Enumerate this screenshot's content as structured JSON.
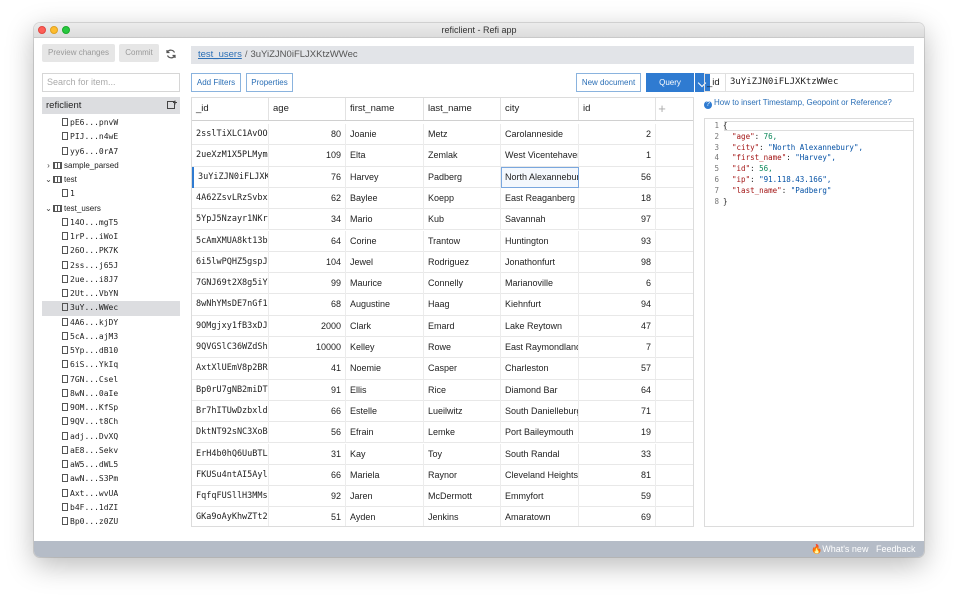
{
  "window": {
    "title": "reficlient - Refi app"
  },
  "sidebar": {
    "preview_label": "Preview changes",
    "commit_label": "Commit",
    "search_placeholder": "Search for item...",
    "root_label": "reficlient",
    "tree": [
      {
        "kind": "doc",
        "label": "pE6...pnvW",
        "indent": 2
      },
      {
        "kind": "doc",
        "label": "PIJ...n4wE",
        "indent": 2
      },
      {
        "kind": "doc",
        "label": "yy6...0rA7",
        "indent": 2
      },
      {
        "kind": "collection",
        "label": "sample_parsed",
        "indent": 0,
        "expanded": false
      },
      {
        "kind": "collection",
        "label": "test",
        "indent": 0,
        "expanded": true
      },
      {
        "kind": "doc",
        "label": "1",
        "indent": 2
      },
      {
        "kind": "collection",
        "label": "test_users",
        "indent": 0,
        "expanded": true
      },
      {
        "kind": "doc",
        "label": "14O...mgT5",
        "indent": 2
      },
      {
        "kind": "doc",
        "label": "1rP...iWoI",
        "indent": 2
      },
      {
        "kind": "doc",
        "label": "26O...PK7K",
        "indent": 2
      },
      {
        "kind": "doc",
        "label": "2ss...j65J",
        "indent": 2
      },
      {
        "kind": "doc",
        "label": "2ue...i8J7",
        "indent": 2
      },
      {
        "kind": "doc",
        "label": "2Ut...VbYN",
        "indent": 2
      },
      {
        "kind": "doc",
        "label": "3uY...WWec",
        "indent": 2,
        "selected": true
      },
      {
        "kind": "doc",
        "label": "4A6...kjDY",
        "indent": 2
      },
      {
        "kind": "doc",
        "label": "5cA...ajM3",
        "indent": 2
      },
      {
        "kind": "doc",
        "label": "5Yp...dB10",
        "indent": 2
      },
      {
        "kind": "doc",
        "label": "6iS...YkIq",
        "indent": 2
      },
      {
        "kind": "doc",
        "label": "7GN...Csel",
        "indent": 2
      },
      {
        "kind": "doc",
        "label": "8wN...0aIe",
        "indent": 2
      },
      {
        "kind": "doc",
        "label": "9OM...KfSp",
        "indent": 2
      },
      {
        "kind": "doc",
        "label": "9QV...t8Ch",
        "indent": 2
      },
      {
        "kind": "doc",
        "label": "adj...DvXQ",
        "indent": 2
      },
      {
        "kind": "doc",
        "label": "aE8...Sekv",
        "indent": 2
      },
      {
        "kind": "doc",
        "label": "aW5...dWL5",
        "indent": 2
      },
      {
        "kind": "doc",
        "label": "awN...S3Pm",
        "indent": 2
      },
      {
        "kind": "doc",
        "label": "Axt...wvUA",
        "indent": 2
      },
      {
        "kind": "doc",
        "label": "b4F...1dZI",
        "indent": 2
      },
      {
        "kind": "doc",
        "label": "Bp0...z0ZU",
        "indent": 2
      }
    ]
  },
  "breadcrumb": {
    "collection": "test_users",
    "separator": "/",
    "document": "3uYiZJN0iFLJXKtzWWec"
  },
  "toolbar": {
    "add_filters": "Add Filters",
    "properties": "Properties",
    "new_document": "New document",
    "query": "Query"
  },
  "table": {
    "columns": [
      "_id",
      "age",
      "first_name",
      "last_name",
      "city",
      "id"
    ],
    "add_column": "+",
    "rows": [
      [
        "2sslTiXLC1AvOO",
        "80",
        "Joanie",
        "Metz",
        "Carolanneside",
        "2"
      ],
      [
        "2ueXzM1X5PLMym",
        "109",
        "Elta",
        "Zemlak",
        "West Vicentehaven",
        "1"
      ],
      [
        "3uYiZJN0iFLJXK",
        "76",
        "Harvey",
        "Padberg",
        "North Alexannebury",
        "56"
      ],
      [
        "4A62ZsvLRzSvbx",
        "62",
        "Baylee",
        "Koepp",
        "East Reaganberg",
        "18"
      ],
      [
        "5YpJ5Nzayr1NKr",
        "34",
        "Mario",
        "Kub",
        "Savannah",
        "97"
      ],
      [
        "5cAmXMUA8kt13b",
        "64",
        "Corine",
        "Trantow",
        "Huntington",
        "93"
      ],
      [
        "6i5lwPQHZ5gspJ",
        "104",
        "Jewel",
        "Rodriguez",
        "Jonathonfurt",
        "98"
      ],
      [
        "7GNJ69t2X8g5iY",
        "99",
        "Maurice",
        "Connelly",
        "Marianoville",
        "6"
      ],
      [
        "8wNhYMsDE7nGf1",
        "68",
        "Augustine",
        "Haag",
        "Kiehnfurt",
        "94"
      ],
      [
        "9OMgjxy1fB3xDJ",
        "2000",
        "Clark",
        "Emard",
        "Lake Reytown",
        "47"
      ],
      [
        "9QVGSlC36WZdSh",
        "10000",
        "Kelley",
        "Rowe",
        "East Raymondland",
        "7"
      ],
      [
        "AxtXlUEmV8p2BR",
        "41",
        "Noemie",
        "Casper",
        "Charleston",
        "57"
      ],
      [
        "Bp0rU7gNB2miDT",
        "91",
        "Ellis",
        "Rice",
        "Diamond Bar",
        "64"
      ],
      [
        "Br7hITUwDzbxld",
        "66",
        "Estelle",
        "Lueilwitz",
        "South Danielleburgh",
        "71"
      ],
      [
        "DktNT92sNC3XoB",
        "56",
        "Efrain",
        "Lemke",
        "Port Baileymouth",
        "19"
      ],
      [
        "ErH4b0hQ6UuBTL",
        "31",
        "Kay",
        "Toy",
        "South Randal",
        "33"
      ],
      [
        "FKUSu4ntAI5Ayl",
        "66",
        "Mariela",
        "Raynor",
        "Cleveland Heights",
        "81"
      ],
      [
        "FqfqFUSllH3MMs",
        "92",
        "Jaren",
        "McDermott",
        "Emmyfort",
        "59"
      ],
      [
        "GKa9oAyKhwZTt2",
        "51",
        "Ayden",
        "Jenkins",
        "Amaratown",
        "69"
      ]
    ],
    "selected_row": 2
  },
  "editor": {
    "field_label": "_id",
    "field_value": "3uYiZJN0iFLJXKtzWWec",
    "help_text": "How to insert Timestamp, Geopoint or Reference?",
    "lines": [
      {
        "no": "1",
        "text": "{"
      },
      {
        "no": "2",
        "text": "  \"age\": 76,"
      },
      {
        "no": "3",
        "text": "  \"city\": \"North Alexannebury\","
      },
      {
        "no": "4",
        "text": "  \"first_name\": \"Harvey\","
      },
      {
        "no": "5",
        "text": "  \"id\": 56,"
      },
      {
        "no": "6",
        "text": "  \"ip\": \"91.118.43.166\","
      },
      {
        "no": "7",
        "text": "  \"last_name\": \"Padberg\""
      },
      {
        "no": "8",
        "text": "}"
      }
    ]
  },
  "statusbar": {
    "whats_new": "🔥What's new",
    "feedback": "Feedback"
  },
  "colors": {
    "accent": "#2f7bd1",
    "link": "#2b6fb6",
    "statusbar": "#b5bcc7",
    "selection": "#dcdde0"
  }
}
